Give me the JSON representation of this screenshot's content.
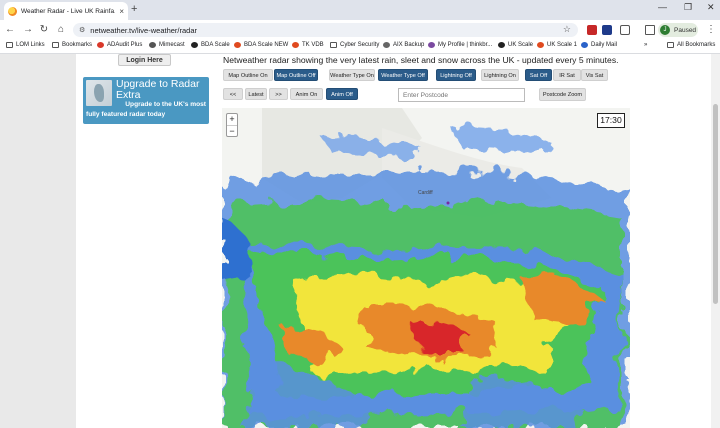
{
  "browser": {
    "tab_title": "Weather Radar - Live UK Rainfa...",
    "tab_close": "×",
    "new_tab": "+",
    "url": "netweather.tv/live-weather/radar",
    "profile_initial": "J",
    "profile_status": "Paused"
  },
  "bookmarks": [
    {
      "label": "LOM Links",
      "icon": "folder-icon",
      "color": "#555555"
    },
    {
      "label": "Bookmarks",
      "icon": "folder-icon",
      "color": "#555555"
    },
    {
      "label": "ADAudit Plus",
      "icon": "adaudit-icon",
      "color": "#d9382a"
    },
    {
      "label": "Mimecast",
      "icon": "mimecast-icon",
      "color": "#555555"
    },
    {
      "label": "BDA Scale",
      "icon": "bda-icon",
      "color": "#222222"
    },
    {
      "label": "BDA Scale NEW",
      "icon": "bda-new-icon",
      "color": "#e04a1f"
    },
    {
      "label": "TK VDB",
      "icon": "tk-icon",
      "color": "#e04a1f"
    },
    {
      "label": "Cyber Security",
      "icon": "folder-icon",
      "color": "#555555"
    },
    {
      "label": "AIX Backup",
      "icon": "globe-icon",
      "color": "#666666"
    },
    {
      "label": "My Profile | thinkbr...",
      "icon": "profile-icon",
      "color": "#7b4aa0"
    },
    {
      "label": "UK Scale",
      "icon": "ukscale-icon",
      "color": "#222222"
    },
    {
      "label": "UK Scale 1",
      "icon": "ukscale1-icon",
      "color": "#e04a1f"
    },
    {
      "label": "Daily Mail",
      "icon": "dailymail-icon",
      "color": "#2a62c9"
    }
  ],
  "bookmarks_more": "»",
  "bookmarks_all": "All Bookmarks",
  "sidebar": {
    "login_label": "Login Here",
    "promo_title": "Upgrade to Radar Extra",
    "promo_sub_line1": "Upgrade to the UK's most",
    "promo_sub_line2": "fully featured radar today"
  },
  "main": {
    "description": "Netweather radar showing the very latest rain, sleet and snow across the UK - updated every 5 minutes.",
    "controls_row1": [
      {
        "label": "Map Outline On",
        "style": "light"
      },
      {
        "label": "Map Outline Off",
        "style": "dark"
      },
      {
        "label": "Weather Type On",
        "style": "light"
      },
      {
        "label": "Weather Type Off",
        "style": "dark"
      },
      {
        "label": "Lightning Off",
        "style": "dark"
      },
      {
        "label": "Lightning On",
        "style": "light"
      },
      {
        "label": "Sat Off",
        "style": "dark"
      },
      {
        "label": "IR Sat",
        "style": "light"
      },
      {
        "label": "Vis Sat",
        "style": "light"
      }
    ],
    "controls_row2": [
      {
        "label": "<<",
        "style": "light"
      },
      {
        "label": "Latest",
        "style": "light"
      },
      {
        "label": ">>",
        "style": "light"
      },
      {
        "label": "Anim On",
        "style": "light"
      },
      {
        "label": "Anim Off",
        "style": "dark"
      }
    ],
    "postcode_placeholder": "Enter Postcode",
    "postcode_zoom_label": "Postcode Zoom",
    "map": {
      "zoom_in": "+",
      "zoom_out": "−",
      "time": "17:30",
      "place_label": "Cardiff"
    }
  },
  "colors": {
    "button_dark": "#2b5c8a",
    "promo": "#4a98c2",
    "rain_light": "#5a8fe0",
    "rain_moderate": "#4cc35a",
    "rain_heavy": "#f2e53a",
    "rain_very_heavy": "#e8892a",
    "rain_extreme": "#d8252a"
  }
}
